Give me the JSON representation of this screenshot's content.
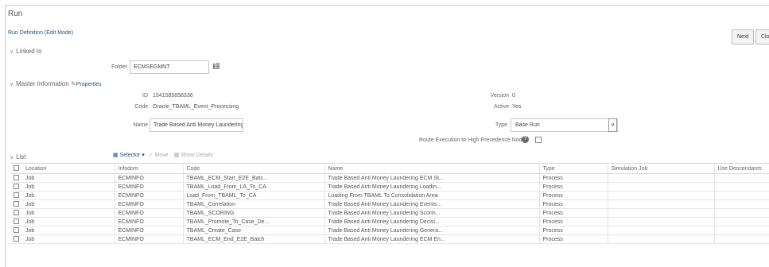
{
  "header": {
    "title": "Run",
    "subtitle": "Run Definition (Edit Mode)",
    "next_label": "Next",
    "close_label": "Clos"
  },
  "linked_to": {
    "section_label": "Linked to",
    "folder_label": "Folder",
    "folder_value": "ECMSEGMNT"
  },
  "master": {
    "section_label": "Master Information",
    "properties_label": "Properties",
    "id_label": "ID",
    "id_value": "1541585658336",
    "code_label": "Code",
    "code_value": "Oracle_TBAML_Event_Processing",
    "name_label": "Name",
    "name_value": "Trade Based Anti Money Laundering E",
    "version_label": "Version",
    "version_value": "0",
    "active_label": "Active",
    "active_value": "Yes",
    "type_label": "Type",
    "type_value": "Base Run",
    "route_label": "Route Execution to High Precedence Node"
  },
  "list": {
    "section_label": "List",
    "toolbar": {
      "selector_label": "Selector",
      "move_label": "Move",
      "show_details_label": "Show Details"
    },
    "columns": [
      "Location",
      "Infodom",
      "Code",
      "Name",
      "Type",
      "Simulation Job",
      "Use Descendants"
    ],
    "rows": [
      {
        "location": "Job",
        "infodom": "ECMINFO",
        "code": "TBAML_ECM_Start_E2E_Batc...",
        "name": "Trade Based Anti Money Laundering ECM St...",
        "type": "Process",
        "sim": "",
        "desc": ""
      },
      {
        "location": "Job",
        "infodom": "ECMINFO",
        "code": "TBAML_Load_From_LA_To_CA",
        "name": "Trade Based Anti Money Laundering Loadin...",
        "type": "Process",
        "sim": "",
        "desc": ""
      },
      {
        "location": "Job",
        "infodom": "ECMINFO",
        "code": "Load_From_TBAML_To_CA",
        "name": "Loading From TBAML To Consolidation Area",
        "type": "Process",
        "sim": "",
        "desc": ""
      },
      {
        "location": "Job",
        "infodom": "ECMINFO",
        "code": "TBAML_Correlation",
        "name": "Trade Based Anti Money Laundering Events...",
        "type": "Process",
        "sim": "",
        "desc": ""
      },
      {
        "location": "Job",
        "infodom": "ECMINFO",
        "code": "TBAML_SCORING",
        "name": "Trade Based Anti Money Laundering Scorin...",
        "type": "Process",
        "sim": "",
        "desc": ""
      },
      {
        "location": "Job",
        "infodom": "ECMINFO",
        "code": "TBAML_Promote_To_Case_De...",
        "name": "Trade Based Anti Money Laundering Decisi...",
        "type": "Process",
        "sim": "",
        "desc": ""
      },
      {
        "location": "Job",
        "infodom": "ECMINFO",
        "code": "TBAML_Create_Case",
        "name": "Trade Based Anti Money Laundering Genera...",
        "type": "Process",
        "sim": "",
        "desc": ""
      },
      {
        "location": "Job",
        "infodom": "ECMINFO",
        "code": "TBAML_ECM_End_E2E_Batch",
        "name": "Trade Based Anti Money Laundering ECM En...",
        "type": "Process",
        "sim": "",
        "desc": ""
      }
    ]
  }
}
